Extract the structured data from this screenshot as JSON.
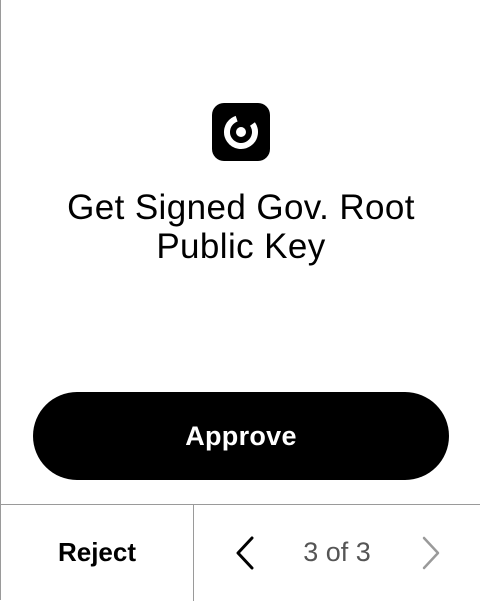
{
  "header": {
    "icon": "app-logo-icon"
  },
  "content": {
    "title": "Get Signed Gov. Root Public Key"
  },
  "actions": {
    "approve_label": "Approve",
    "reject_label": "Reject"
  },
  "pagination": {
    "current": 3,
    "total": 3,
    "label": "3 of 3",
    "prev_icon": "chevron-left-icon",
    "next_icon": "chevron-right-icon",
    "next_enabled": false
  },
  "colors": {
    "primary": "#000000",
    "background": "#ffffff",
    "border": "#9a9a9a",
    "muted_text": "#555555",
    "disabled_icon": "#9a9a9a"
  }
}
